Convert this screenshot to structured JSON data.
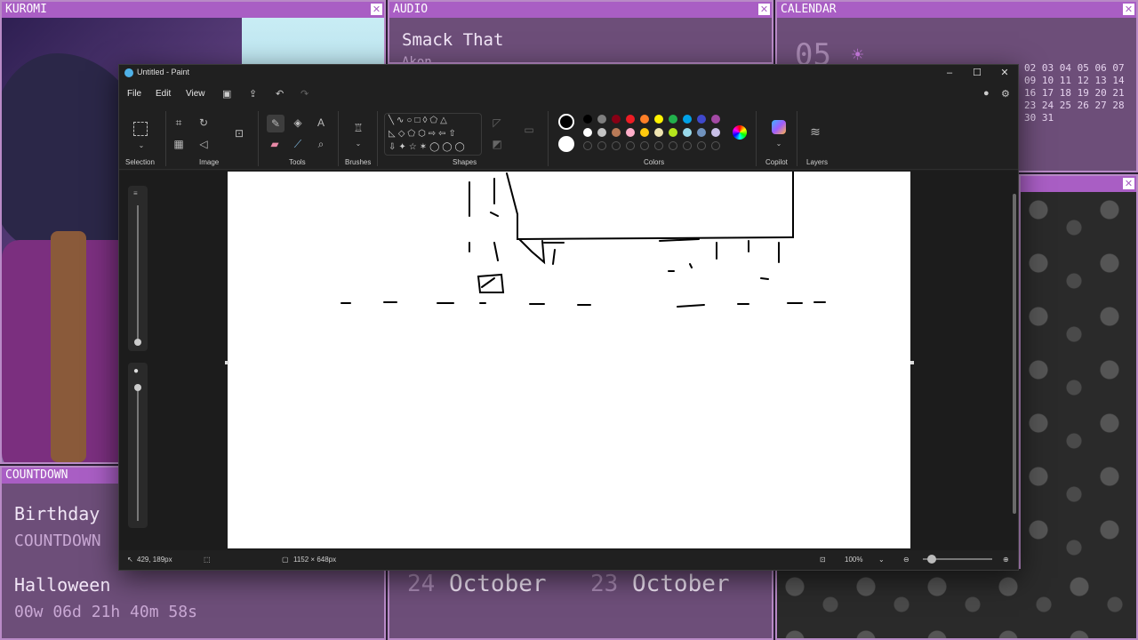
{
  "panels": {
    "kuromi": {
      "title": "KUROMI"
    },
    "audio": {
      "title": "AUDIO",
      "track": "Smack That",
      "artist": "Akon"
    },
    "calendar": {
      "title": "CALENDAR",
      "day": "05",
      "rows": [
        "02 03 04 05 06 07",
        "09 10 11 12 13 14",
        "16 17 18 19 20 21",
        "23 24 25 26 27 28",
        "30 31"
      ]
    },
    "countdown": {
      "title": "COUNTDOWN",
      "heading": "Birthday",
      "subheading": "COUNTDOWN",
      "event": "Halloween",
      "remaining": "00w 06d 21h 40m 58s"
    },
    "dates": {
      "a_num": "24",
      "a_month": "October",
      "b_num": "23",
      "b_month": "October"
    },
    "close_glyph": "✕"
  },
  "paint": {
    "title": "Untitled - Paint",
    "menu": {
      "file": "File",
      "edit": "Edit",
      "view": "View"
    },
    "groups": {
      "selection": "Selection",
      "image": "Image",
      "tools": "Tools",
      "brushes": "Brushes",
      "shapes": "Shapes",
      "colors": "Colors",
      "copilot": "Copilot",
      "layers": "Layers"
    },
    "palette_row1": [
      "#000000",
      "#7f7f7f",
      "#880015",
      "#ed1c24",
      "#ff7f27",
      "#fff200",
      "#22b14c",
      "#00a2e8",
      "#3f48cc",
      "#a349a4"
    ],
    "palette_row2": [
      "#ffffff",
      "#c3c3c3",
      "#b97a57",
      "#ffaec9",
      "#ffc90e",
      "#efe4b0",
      "#b5e61d",
      "#99d9ea",
      "#7092be",
      "#c8bfe7"
    ],
    "primary_color": "#000000",
    "secondary_color": "#ffffff",
    "status": {
      "cursor": "429, 189px",
      "canvas_size": "1152 × 648px",
      "zoom": "100%"
    }
  }
}
